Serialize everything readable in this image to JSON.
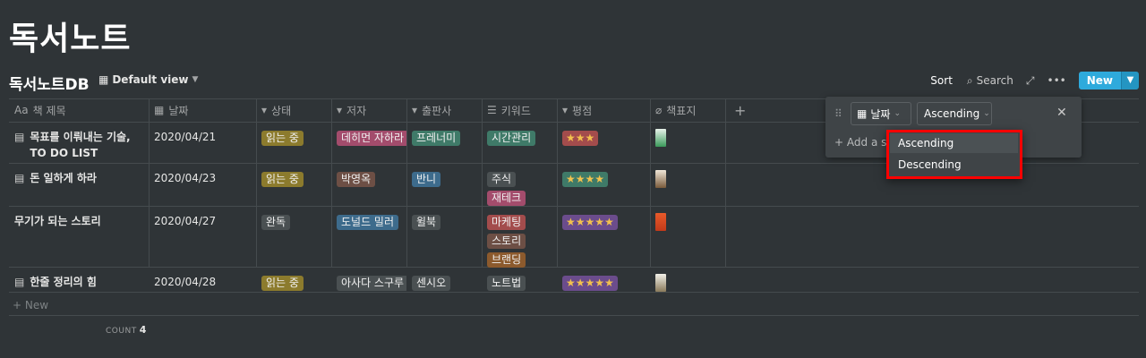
{
  "page": {
    "title": "독서노트"
  },
  "database": {
    "title": "독서노트DB",
    "view_label": "Default view"
  },
  "toolbar": {
    "sort_label": "Sort",
    "search_label": "Search",
    "new_label": "New"
  },
  "columns": [
    "책 제목",
    "날짜",
    "상태",
    "저자",
    "출판사",
    "키워드",
    "평점",
    "책표지"
  ],
  "rows": [
    {
      "title": "목표를 이뤄내는 기술, TO DO LIST",
      "date": "2020/04/21",
      "status": "읽는 중",
      "author": "데히먼 자하라",
      "publisher": "프레너미",
      "keywords": [
        "시간관리"
      ],
      "rating": "★★★",
      "stars": 3
    },
    {
      "title": "돈 일하게 하라",
      "date": "2020/04/23",
      "status": "읽는 중",
      "author": "박영옥",
      "publisher": "반니",
      "keywords": [
        "주식",
        "재테크"
      ],
      "rating": "★★★★",
      "stars": 4
    },
    {
      "title": "무기가 되는 스토리",
      "date": "2020/04/27",
      "status": "완독",
      "author": "도널드 밀러",
      "publisher": "윌북",
      "keywords": [
        "마케팅",
        "스토리",
        "브랜딩"
      ],
      "rating": "★★★★★",
      "stars": 5
    },
    {
      "title": "한줄 정리의 힘",
      "date": "2020/04/28",
      "status": "읽는 중",
      "author": "아사다 스구루",
      "publisher": "센시오",
      "keywords": [
        "노트법"
      ],
      "rating": "★★★★★",
      "stars": 5
    }
  ],
  "footer": {
    "add_new_label": "New",
    "count_label": "COUNT",
    "count_value": "4"
  },
  "sort_panel": {
    "property": "날짜",
    "direction": "Ascending",
    "add_sort_label": "Add a s"
  },
  "dropdown": {
    "options": [
      "Ascending",
      "Descending"
    ],
    "selected": "Ascending"
  },
  "colors": {
    "background": "#2f3437",
    "accent": "#2eaadc",
    "highlight_box": "#ff0000",
    "status_reading": "#8c7b2d",
    "status_done": "#4a5052"
  }
}
